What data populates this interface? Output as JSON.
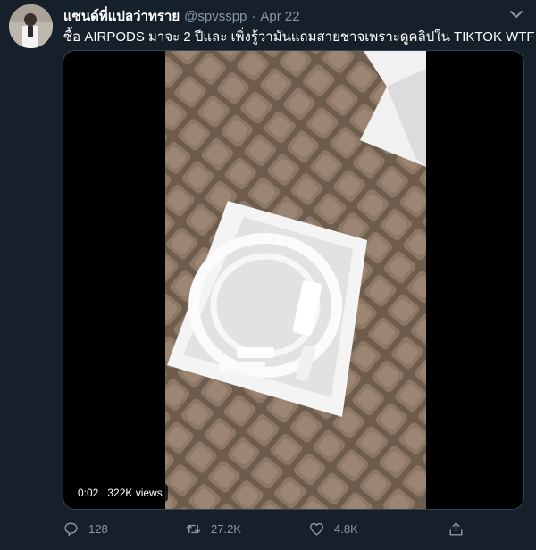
{
  "tweet": {
    "display_name": "แซนด์ที่แปลว่าทราย",
    "handle": "@spvsspp",
    "separator": "·",
    "date": "Apr 22",
    "text": "ซื้อ AIRPODS มาจะ 2 ปีและ เพิ่งรู้ว่ามันแถมสายชาจเพราะดูคลิปใน TIKTOK WTF!!!"
  },
  "video": {
    "time": "0:02",
    "views": "322K views"
  },
  "actions": {
    "reply_count": "128",
    "retweet_count": "27.2K",
    "like_count": "4.8K"
  },
  "icons": {
    "more": "chevron-down-icon",
    "reply": "reply-icon",
    "retweet": "retweet-icon",
    "like": "heart-icon",
    "share": "share-icon"
  },
  "colors": {
    "background": "#15202b",
    "secondary_text": "#8899a6",
    "border": "#38444d"
  }
}
